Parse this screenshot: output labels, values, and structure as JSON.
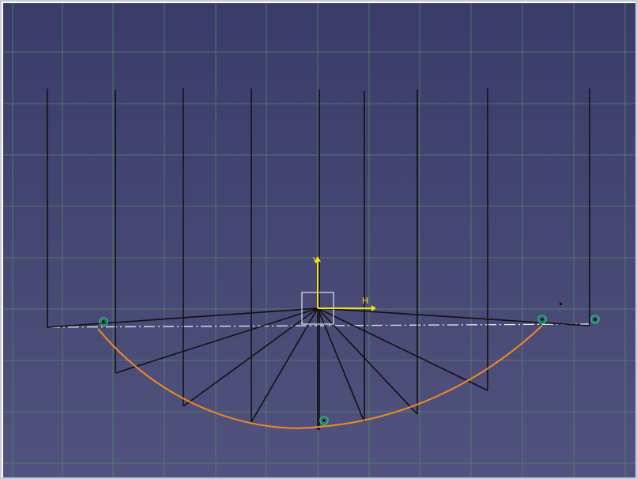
{
  "viewport": {
    "background_top": "#3b3b6a",
    "background_bottom": "#52527e",
    "grid_color": "#4f8a6c",
    "line_color": "#111111",
    "construction_line_color": "#e8e8f0",
    "arc_color": "#f08a24",
    "point_color": "#1ec07a",
    "axis_color": "#f2e21a"
  },
  "sketch": {
    "horizontal_axis_label": "H",
    "vertical_axis_label": "V"
  },
  "icons": {
    "origin_square": "origin-square-icon",
    "coincidence_points": "coincidence-point-icon"
  }
}
